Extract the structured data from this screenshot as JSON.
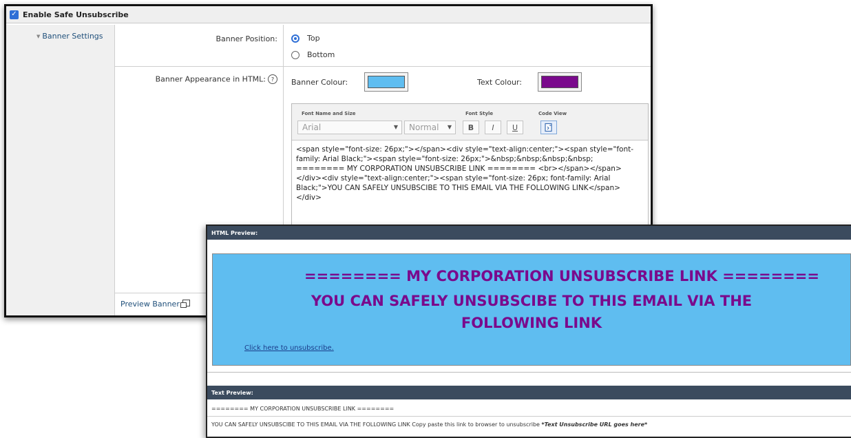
{
  "settings": {
    "enable_label": "Enable Safe Unsubscribe",
    "banner_settings_label": "Banner Settings",
    "banner_position_label": "Banner Position:",
    "position_options": [
      {
        "label": "Top",
        "selected": true
      },
      {
        "label": "Bottom",
        "selected": false
      }
    ],
    "banner_appearance_label": "Banner Appearance in HTML:",
    "help_glyph": "?",
    "banner_colour_label": "Banner Colour:",
    "banner_colour": "#5fbdf0",
    "text_colour_label": "Text Colour:",
    "text_colour": "#7a0a8c",
    "preview_banner_label": "Preview Banner",
    "toolbar": {
      "font_group_label": "Font Name and Size",
      "font_value": "Arial",
      "size_value": "Normal",
      "style_group_label": "Font Style",
      "bold": "B",
      "italic": "I",
      "underline": "U",
      "code_view_label": "Code View"
    },
    "code": "<span style=\"font-size: 26px;\"></span><div style=\"text-align:center;\"><span style=\"font-family: Arial Black;\"><span style=\"font-size: 26px;\">&nbsp;&nbsp;&nbsp;&nbsp; ======== MY CORPORATION UNSUBSCRIBE LINK ======== <br></span></span></div><div style=\"text-align:center;\"><span style=\"font-size: 26px; font-family: Arial Black;\">YOU CAN SAFELY UNSUBSCIBE TO THIS EMAIL VIA THE FOLLOWING LINK</span></div>"
  },
  "preview": {
    "html_header": "HTML Preview:",
    "banner_line1": "======== MY CORPORATION UNSUBSCRIBE LINK ========",
    "banner_line2": "YOU CAN SAFELY UNSUBSCIBE TO THIS EMAIL VIA THE",
    "banner_line3": "FOLLOWING LINK",
    "unsubscribe_link": "Click here to unsubscribe.",
    "text_header": "Text Preview:",
    "text_line1": "======== MY CORPORATION UNSUBSCRIBE LINK ========",
    "text_line2_prefix": "YOU CAN SAFELY UNSUBSCIBE TO THIS EMAIL VIA THE FOLLOWING LINK Copy paste this link to browser to unsubscribe ",
    "text_line2_url": "*Text Unsubscribe URL goes here*"
  }
}
